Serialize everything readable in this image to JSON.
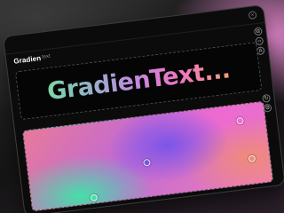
{
  "app": {
    "logo_bold": "Gradien",
    "logo_thin": "text"
  },
  "preview": {
    "text": "GradienText..."
  },
  "controls": {
    "close_icon": "close-icon",
    "preview_buttons": [
      "copy-icon",
      "code-icon",
      "text-icon"
    ],
    "canvas_buttons": [
      "shuffle-icon",
      "settings-icon"
    ]
  },
  "gradient": {
    "stops": [
      {
        "name": "green",
        "color": "#45e0a8"
      },
      {
        "name": "violet",
        "color": "#7c55e8"
      },
      {
        "name": "pink",
        "color": "#f06ad2"
      },
      {
        "name": "peach",
        "color": "#f08a7a"
      }
    ]
  }
}
